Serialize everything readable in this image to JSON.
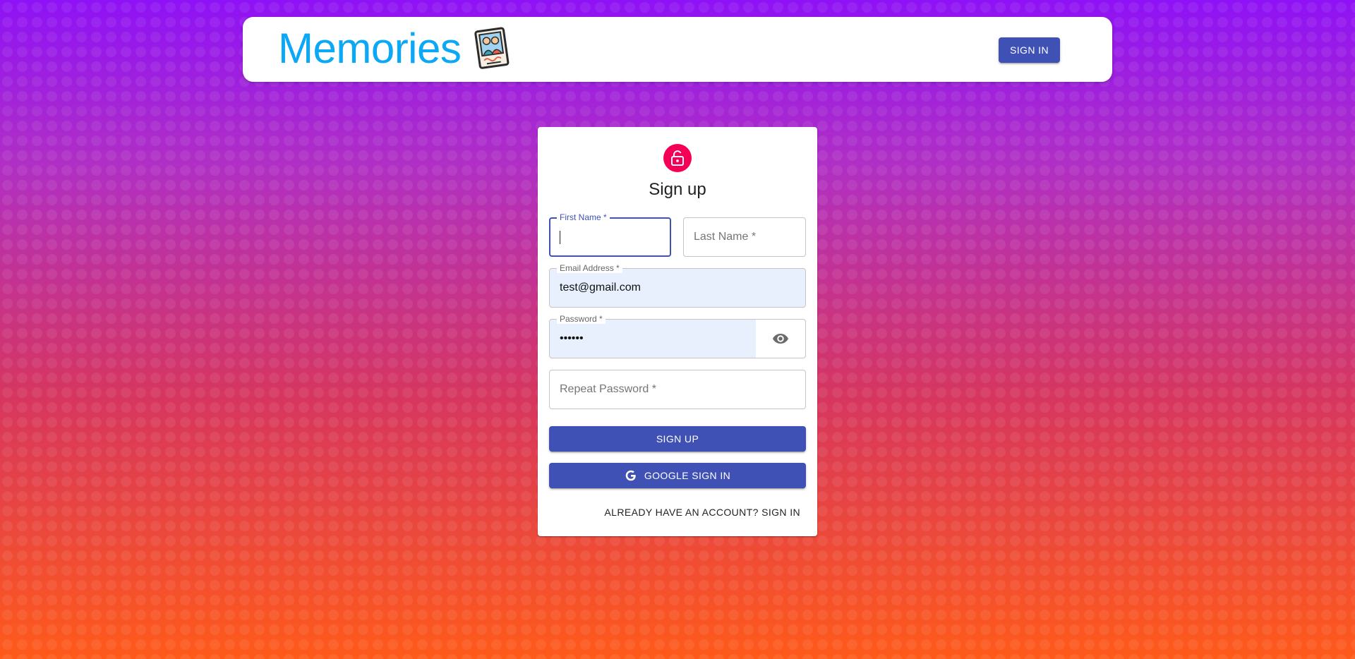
{
  "appbar": {
    "brand_title": "Memories",
    "logo_icon": "memories-photo-icon",
    "signin_label": "SIGN IN"
  },
  "form": {
    "avatar_icon": "lock-open-icon",
    "title": "Sign up",
    "first_name": {
      "label": "First Name *",
      "value": ""
    },
    "last_name": {
      "placeholder": "Last Name *"
    },
    "email": {
      "label": "Email Address *",
      "value": "test@gmail.com"
    },
    "password": {
      "label": "Password *",
      "value": "••••••",
      "toggle_icon": "eye-icon"
    },
    "repeat_password": {
      "placeholder": "Repeat Password *"
    },
    "signup_label": "SIGN UP",
    "google_label": "GOOGLE SIGN IN",
    "google_icon": "google-icon",
    "switch_label": "ALREADY HAVE AN ACCOUNT? SIGN IN"
  },
  "colors": {
    "primary": "#3f51b5",
    "secondary": "#f50057",
    "brand": "#0aa8f5",
    "autofill": "#e8f0fe"
  }
}
